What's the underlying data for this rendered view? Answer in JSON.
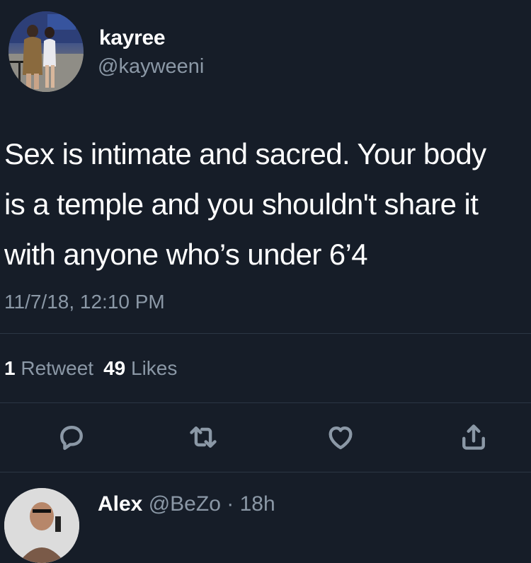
{
  "author": {
    "display_name": "kayree",
    "handle": "@kayweeni",
    "avatar_icon": "profile-photo"
  },
  "tweet": {
    "lines": [
      "Sex is intimate and sacred. Your body",
      "is a temple and you shouldn't share it",
      "with anyone who’s under 6’4"
    ],
    "timestamp": "11/7/18, 12:10 PM"
  },
  "stats": {
    "retweets_count": "1",
    "retweets_label": "Retweet",
    "likes_count": "49",
    "likes_label": "Likes"
  },
  "actions": [
    {
      "icon": "reply-icon"
    },
    {
      "icon": "retweet-icon"
    },
    {
      "icon": "like-icon"
    },
    {
      "icon": "share-icon"
    }
  ],
  "reply": {
    "display_name": "Alex",
    "handle": "@BeZo",
    "separator": "·",
    "time": "18h"
  },
  "colors": {
    "background": "#161d28",
    "text_primary": "#ffffff",
    "text_secondary": "#8b98a6",
    "divider": "#2b3644"
  }
}
